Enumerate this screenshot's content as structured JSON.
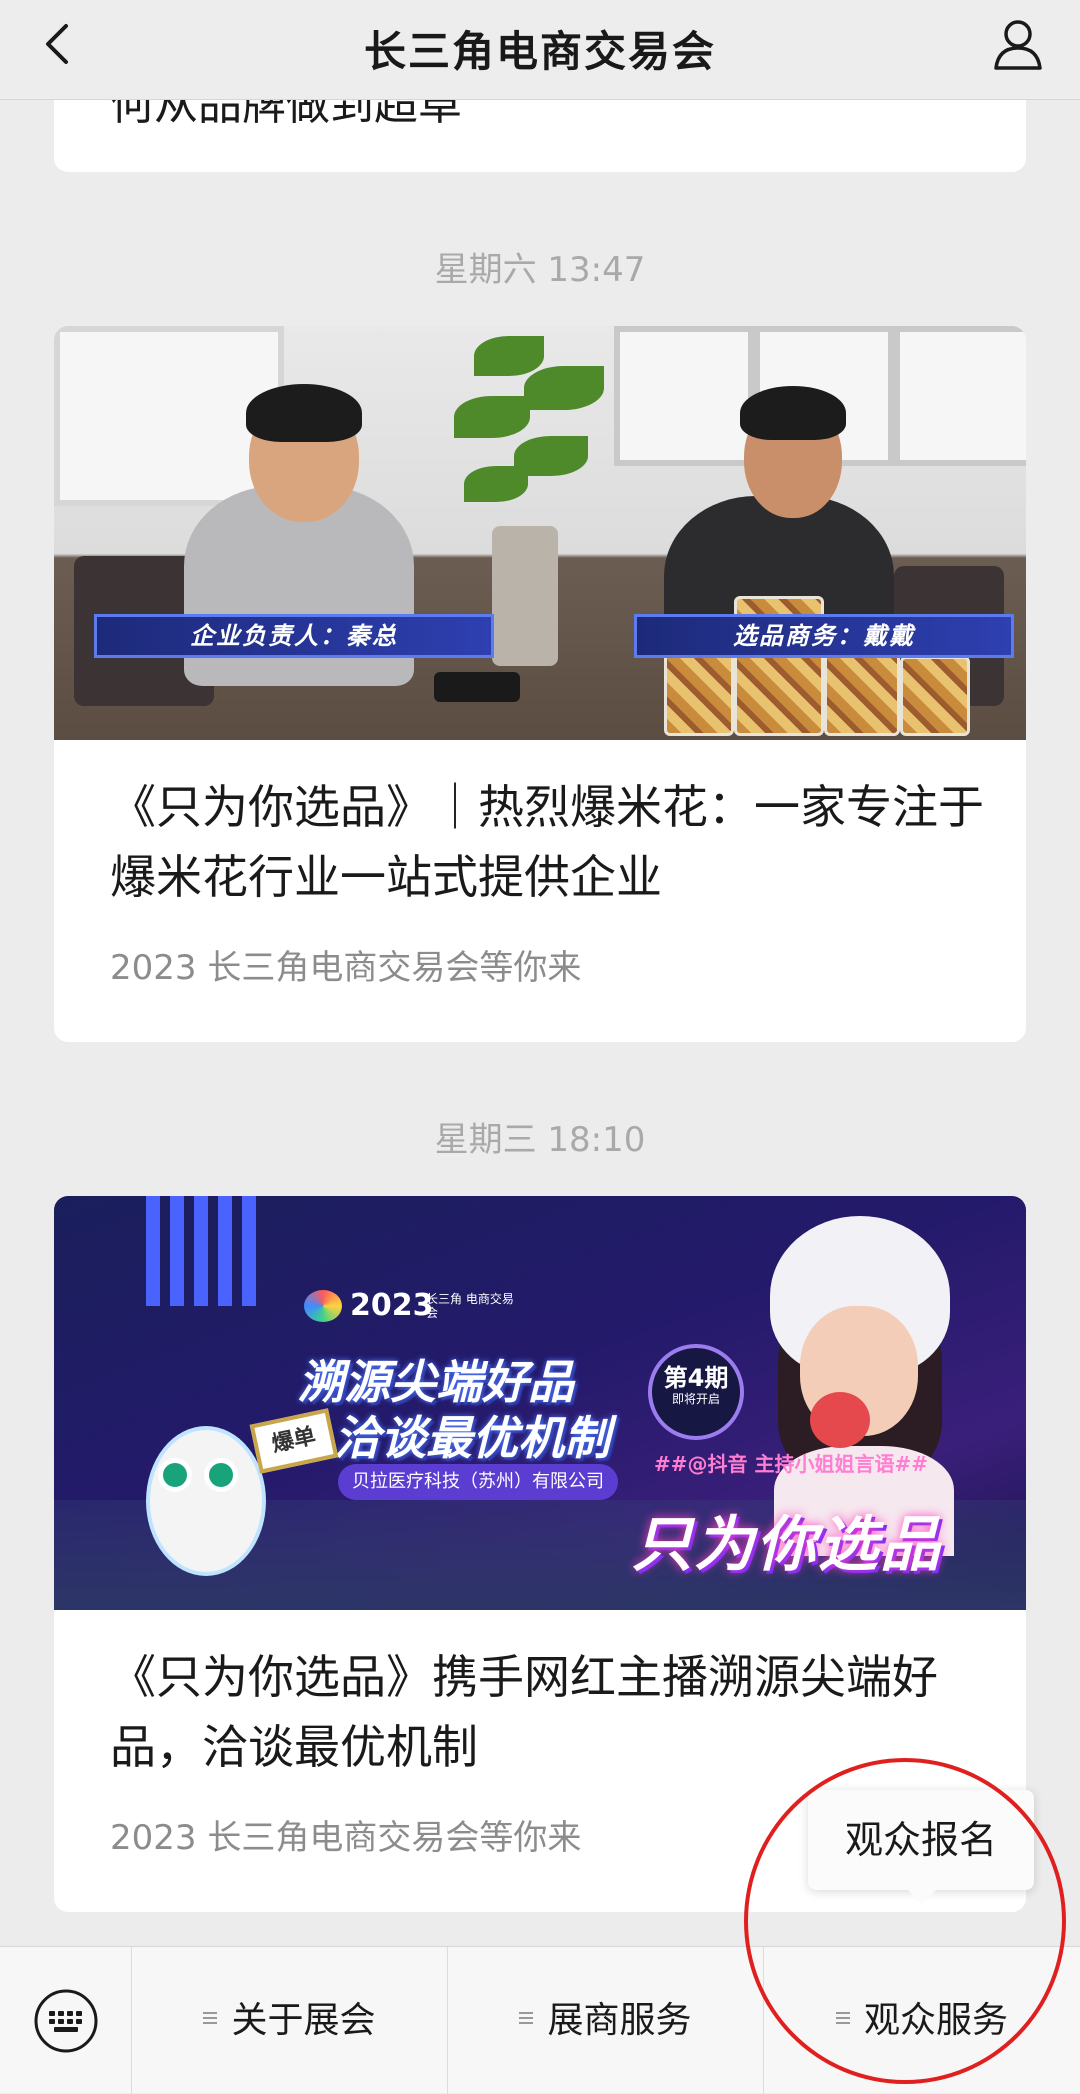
{
  "header": {
    "title": "长三角电商交易会",
    "back_icon": "chevron-left-icon",
    "profile_icon": "person-icon"
  },
  "feed": {
    "top_card": {
      "partial_title": "何从品牌做到超卓"
    },
    "items": [
      {
        "timestamp": "星期六 13:47",
        "cover": {
          "left_caption": "企业负责人：秦总",
          "right_caption": "选品商务：戴戴"
        },
        "title": "《只为你选品》｜热烈爆米花：一家专注于爆米花行业一站式提供企业",
        "subtitle": "2023 长三角电商交易会等你来"
      },
      {
        "timestamp": "星期三 18:10",
        "cover": {
          "logo_year": "2023",
          "logo_small": "长三角 电商交易会",
          "headline_1": "溯源尖端好品",
          "headline_2": "洽谈最优机制",
          "company": "贝拉医疗科技（苏州）有限公司",
          "badge_line1": "第4期",
          "badge_line2": "即将开启",
          "tag": "##@抖音 主持小姐姐言语##",
          "main": "只为你选品",
          "mascot_sign": "爆单"
        },
        "title": "《只为你选品》携手网红主播溯源尖端好品，洽谈最优机制",
        "subtitle": "2023 长三角电商交易会等你来"
      }
    ]
  },
  "popup": {
    "label": "观众报名"
  },
  "menu": {
    "keyboard_icon": "keyboard-icon",
    "items": [
      {
        "label": "关于展会"
      },
      {
        "label": "展商服务"
      },
      {
        "label": "观众服务"
      }
    ]
  },
  "colors": {
    "accent_red": "#e0201e",
    "background": "#ececec",
    "text_gray": "#8c8c8c"
  }
}
